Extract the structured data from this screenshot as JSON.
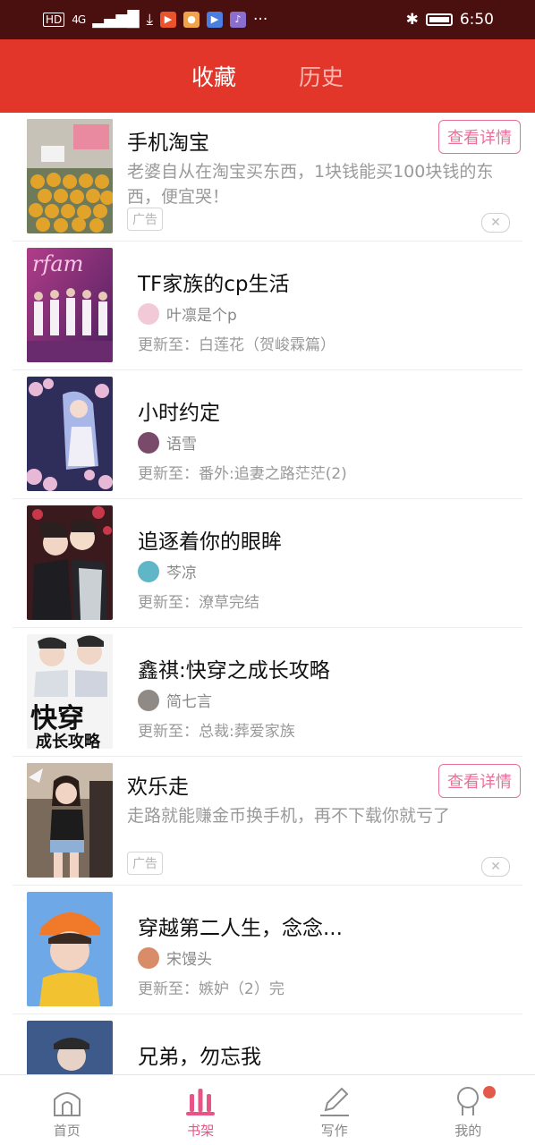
{
  "status_bar": {
    "network": "HD",
    "signal": "4G",
    "time": "6:50",
    "icons": [
      "download-icon",
      "video-app-icon",
      "photo-app-icon",
      "play-app-icon",
      "music-app-icon",
      "more-icon",
      "bluetooth-icon",
      "battery-icon"
    ]
  },
  "header": {
    "tabs": [
      {
        "label": "收藏",
        "active": true
      },
      {
        "label": "历史",
        "active": false
      }
    ],
    "accent_color": "#e3362b"
  },
  "ad1": {
    "title": "手机淘宝",
    "description": "老婆自从在淘宝买东西，1块钱能买100块钱的东西，便宜哭！",
    "detail_label": "查看详情",
    "tag": "广告"
  },
  "books": [
    {
      "title": "TF家族的cp生活",
      "author": "叶凛是个p",
      "update": "更新至：白莲花（贺峻霖篇）"
    },
    {
      "title": "小时约定",
      "author": "语雪",
      "update": "更新至：番外:追妻之路茫茫(2)"
    },
    {
      "title": "追逐着你的眼眸",
      "author": "芩凉",
      "update": "更新至：潦草完结"
    },
    {
      "title": "鑫祺:快穿之成长攻略",
      "author": "简七言",
      "update": "更新至：总裁:葬爱家族"
    }
  ],
  "ad2": {
    "title": "欢乐走",
    "description": "走路就能赚金币换手机，再不下载你就亏了",
    "detail_label": "查看详情",
    "tag": "广告"
  },
  "books2": [
    {
      "title": "穿越第二人生，念念...",
      "author": "宋馒头",
      "update": "更新至：嫉妒（2）完"
    },
    {
      "title": "兄弟，勿忘我",
      "author": "",
      "update": ""
    }
  ],
  "bottom_nav": [
    {
      "label": "首页",
      "icon": "home-icon",
      "active": false
    },
    {
      "label": "书架",
      "icon": "bookshelf-icon",
      "active": true
    },
    {
      "label": "写作",
      "icon": "pen-icon",
      "active": false
    },
    {
      "label": "我的",
      "icon": "profile-icon",
      "active": false
    }
  ]
}
